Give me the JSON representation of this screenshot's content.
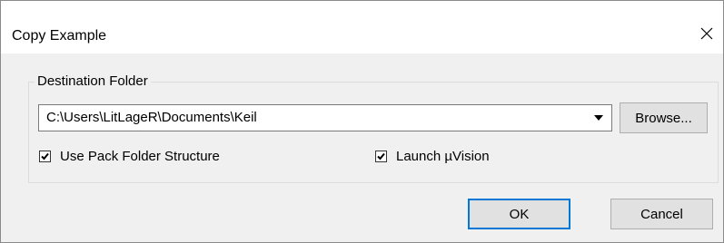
{
  "window": {
    "title": "Copy Example",
    "close_label": "×"
  },
  "destination": {
    "group_label": "Destination Folder",
    "path_value": "C:\\Users\\LitLageR\\Documents\\Keil",
    "browse_label": "Browse..."
  },
  "options": {
    "use_pack_folder_structure": {
      "label": "Use Pack Folder Structure",
      "checked": true
    },
    "launch_uvision": {
      "label": "Launch µVision",
      "checked": true
    }
  },
  "buttons": {
    "ok_label": "OK",
    "cancel_label": "Cancel"
  },
  "colors": {
    "dialog_background": "#f0f0f0",
    "title_background": "#ffffff",
    "default_button_border": "#0078d7",
    "button_face": "#e1e1e1"
  },
  "icons": {
    "close": "close-icon",
    "dropdown": "dropdown-arrow-icon",
    "check": "checkmark-icon"
  }
}
